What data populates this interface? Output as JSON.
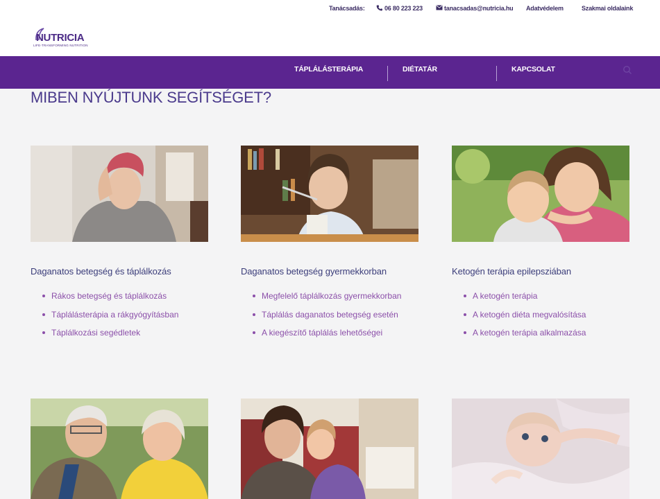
{
  "util": {
    "advice_label": "Tanácsadás:",
    "phone": "06 80 223 223",
    "email": "tanacsadas@nutricia.hu",
    "privacy": "Adatvédelem",
    "professional": "Szakmai oldalaink"
  },
  "logo": {
    "word": "NUTRICIA",
    "tagline": "LIFE-TRANSFORMING NUTRITION"
  },
  "nav": {
    "items": [
      "TÁPLÁLÁSTERÁPIA",
      "DIÉTATÁR",
      "KAPCSOLAT"
    ]
  },
  "headline": "MIBEN NYÚJTUNK SEGÍTSÉGET?",
  "cards": [
    {
      "title": "Daganatos betegség és táplálkozás",
      "links": [
        "Rákos betegség és táplálkozás",
        "Táplálásterápia a rákgyógyításban",
        "Táplálkozási segédletek"
      ]
    },
    {
      "title": "Daganatos betegség gyermekkorban",
      "links": [
        "Megfelelő táplálkozás gyermekkorban",
        "Táplálás daganatos betegség esetén",
        "A kiegészítő táplálás lehetőségei"
      ]
    },
    {
      "title": "Ketogén terápia epilepsziában",
      "links": [
        "A ketogén terápia",
        "A ketogén diéta megvalósítása",
        "A ketogén terápia alkalmazása"
      ]
    }
  ],
  "colors": {
    "brand_purple": "#5b2590",
    "link_purple": "#8b4fa9",
    "title_navy": "#3b3d7a"
  }
}
